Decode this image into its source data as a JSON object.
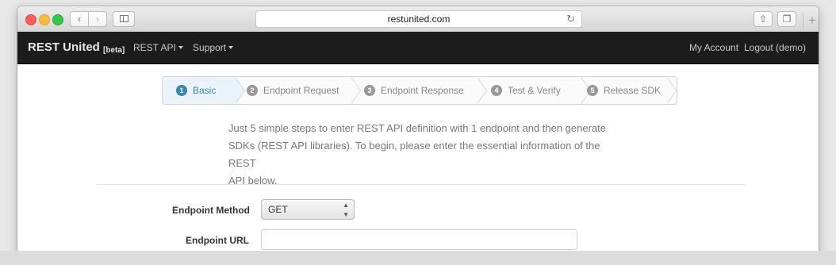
{
  "browser": {
    "url": "restunited.com",
    "icons": {
      "back": "chevron-left-icon",
      "forward": "chevron-right-icon",
      "sidebar": "sidebar-icon",
      "reload": "reload-icon",
      "share": "share-icon",
      "tabs": "tabs-icon",
      "new_tab": "plus-icon"
    }
  },
  "navbar": {
    "brand": "REST United",
    "brand_suffix": "[beta]",
    "menu": [
      {
        "label": "REST API"
      },
      {
        "label": "Support"
      }
    ],
    "right": [
      {
        "label": "My Account"
      },
      {
        "label": "Logout (demo)"
      }
    ]
  },
  "wizard": {
    "active_step": 1,
    "steps": [
      {
        "num": "1",
        "label": "Basic"
      },
      {
        "num": "2",
        "label": "Endpoint Request"
      },
      {
        "num": "3",
        "label": "Endpoint Response"
      },
      {
        "num": "4",
        "label": "Test & Verify"
      },
      {
        "num": "5",
        "label": "Release SDK"
      }
    ]
  },
  "intro": {
    "line1": "Just 5 simple steps to enter REST API definition with 1 endpoint and then generate",
    "line2": "SDKs (REST API libraries). To begin, please enter the essential information of the REST",
    "line3": "API below."
  },
  "form": {
    "method_label": "Endpoint Method",
    "method_value": "GET",
    "url_label": "Endpoint URL",
    "url_value": ""
  },
  "colors": {
    "navbar_bg": "#1c1c1c",
    "active_step_bg": "#eaf2fa",
    "active_step_text": "#3a87ad"
  }
}
